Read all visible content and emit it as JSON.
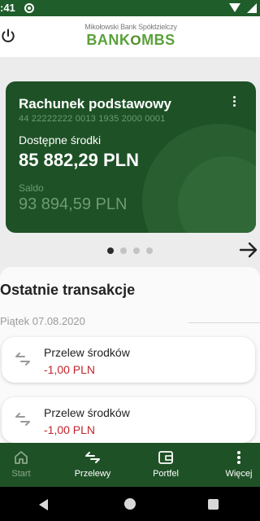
{
  "status_bar": {
    "time": ":41"
  },
  "brand": {
    "bank_name": "Mikołowski Bank Spółdzielczy",
    "logo_left": "BANK",
    "logo_mid": "O",
    "logo_right": "MBS"
  },
  "account": {
    "name": "Rachunek podstawowy",
    "number": "44 22222222 0013 1935 2000 0001",
    "available_label": "Dostępne środki",
    "available_amount": "85 882,29 PLN",
    "balance_label": "Saldo",
    "balance_amount": "93 894,59 PLN"
  },
  "pager": {
    "total": 4,
    "active": 1
  },
  "transactions": {
    "title": "Ostatnie transakcje",
    "date": "Piątek 07.08.2020",
    "items": [
      {
        "name": "Przelew środków",
        "amount": "-1,00 PLN"
      },
      {
        "name": "Przelew środków",
        "amount": "-1,00 PLN"
      }
    ]
  },
  "nav": {
    "start": "Start",
    "transfers": "Przelewy",
    "wallet": "Portfel",
    "more": "Więcej"
  },
  "colors": {
    "brand_green": "#1f5126",
    "card_green": "#1e5126",
    "negative_red": "#c2262d",
    "logo_green": "#5aa13b"
  }
}
